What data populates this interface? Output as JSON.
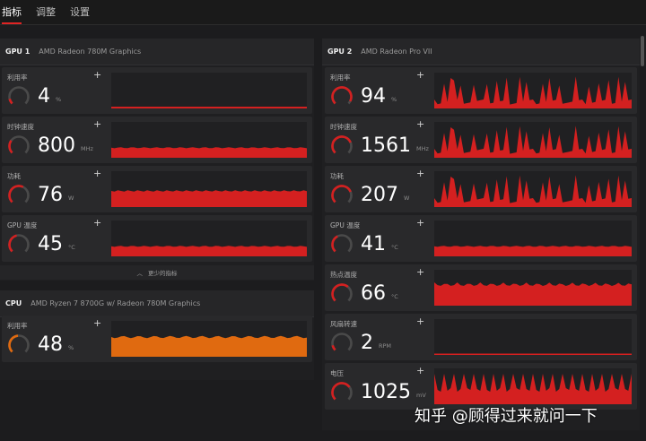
{
  "tabs": [
    "指标",
    "调整",
    "设置"
  ],
  "gpu1": {
    "name": "GPU 1",
    "desc": "AMD Radeon 780M Graphics",
    "metrics": [
      {
        "label": "利用率",
        "value": "4",
        "unit": "%",
        "level": 0.04
      },
      {
        "label": "时钟速度",
        "value": "800",
        "unit": "MHz",
        "level": 0.3
      },
      {
        "label": "功耗",
        "value": "76",
        "unit": "W",
        "level": 0.6
      },
      {
        "label": "GPU 温度",
        "value": "45",
        "unit": "°C",
        "level": 0.45
      }
    ],
    "collapse_label": "更少的指标"
  },
  "cpu": {
    "name": "CPU",
    "desc": "AMD Ryzen 7 8700G w/ Radeon 780M Graphics",
    "metrics": [
      {
        "label": "利用率",
        "value": "48",
        "unit": "%",
        "level": 0.48
      }
    ]
  },
  "gpu2": {
    "name": "GPU 2",
    "desc": "AMD Radeon Pro VII",
    "metrics": [
      {
        "label": "利用率",
        "value": "94",
        "unit": "%",
        "level": 0.94
      },
      {
        "label": "时钟速度",
        "value": "1561",
        "unit": "MHz",
        "level": 0.75
      },
      {
        "label": "功耗",
        "value": "207",
        "unit": "W",
        "level": 0.75
      },
      {
        "label": "GPU 温度",
        "value": "41",
        "unit": "°C",
        "level": 0.4
      },
      {
        "label": "热点温度",
        "value": "66",
        "unit": "°C",
        "level": 0.65
      },
      {
        "label": "风扇转速",
        "value": "2",
        "unit": "RPM",
        "level": 0.0
      },
      {
        "label": "电压",
        "value": "1025",
        "unit": "mV",
        "level": 0.7
      }
    ]
  },
  "watermark": "知乎 @顾得过来就问一下",
  "colors": {
    "accent": "#d42020",
    "cpu": "#e06a10",
    "track": "#4a4a4a"
  }
}
